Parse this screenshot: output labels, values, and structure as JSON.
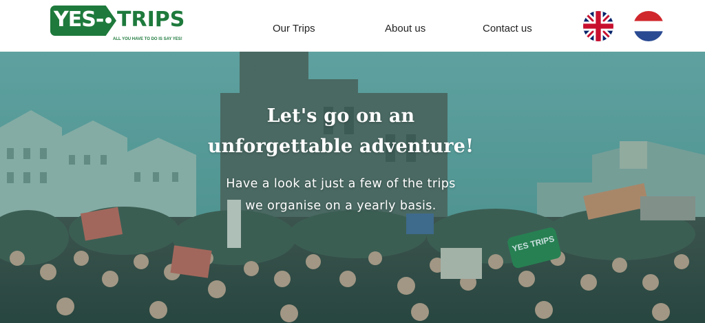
{
  "brand": {
    "logo_left": "YES-",
    "logo_right": "TRIPS",
    "tagline": "ALL YOU HAVE TO DO IS SAY YES!",
    "color": "#1e7a3c"
  },
  "nav": {
    "items": [
      {
        "label": "Our Trips"
      },
      {
        "label": "About us"
      },
      {
        "label": "Contact us"
      }
    ]
  },
  "languages": [
    {
      "name": "English",
      "icon": "uk-flag-icon"
    },
    {
      "name": "Dutch",
      "icon": "netherlands-flag-icon"
    }
  ],
  "hero": {
    "title_line1": "Let's go on an",
    "title_line2": "unforgettable adventure!",
    "subtitle_line1": "Have a look at just a few of the trips",
    "subtitle_line2": "we organise on a yearly basis.",
    "overlay_color": "#3f8f8c",
    "sign_text": "YES TRIPS"
  }
}
